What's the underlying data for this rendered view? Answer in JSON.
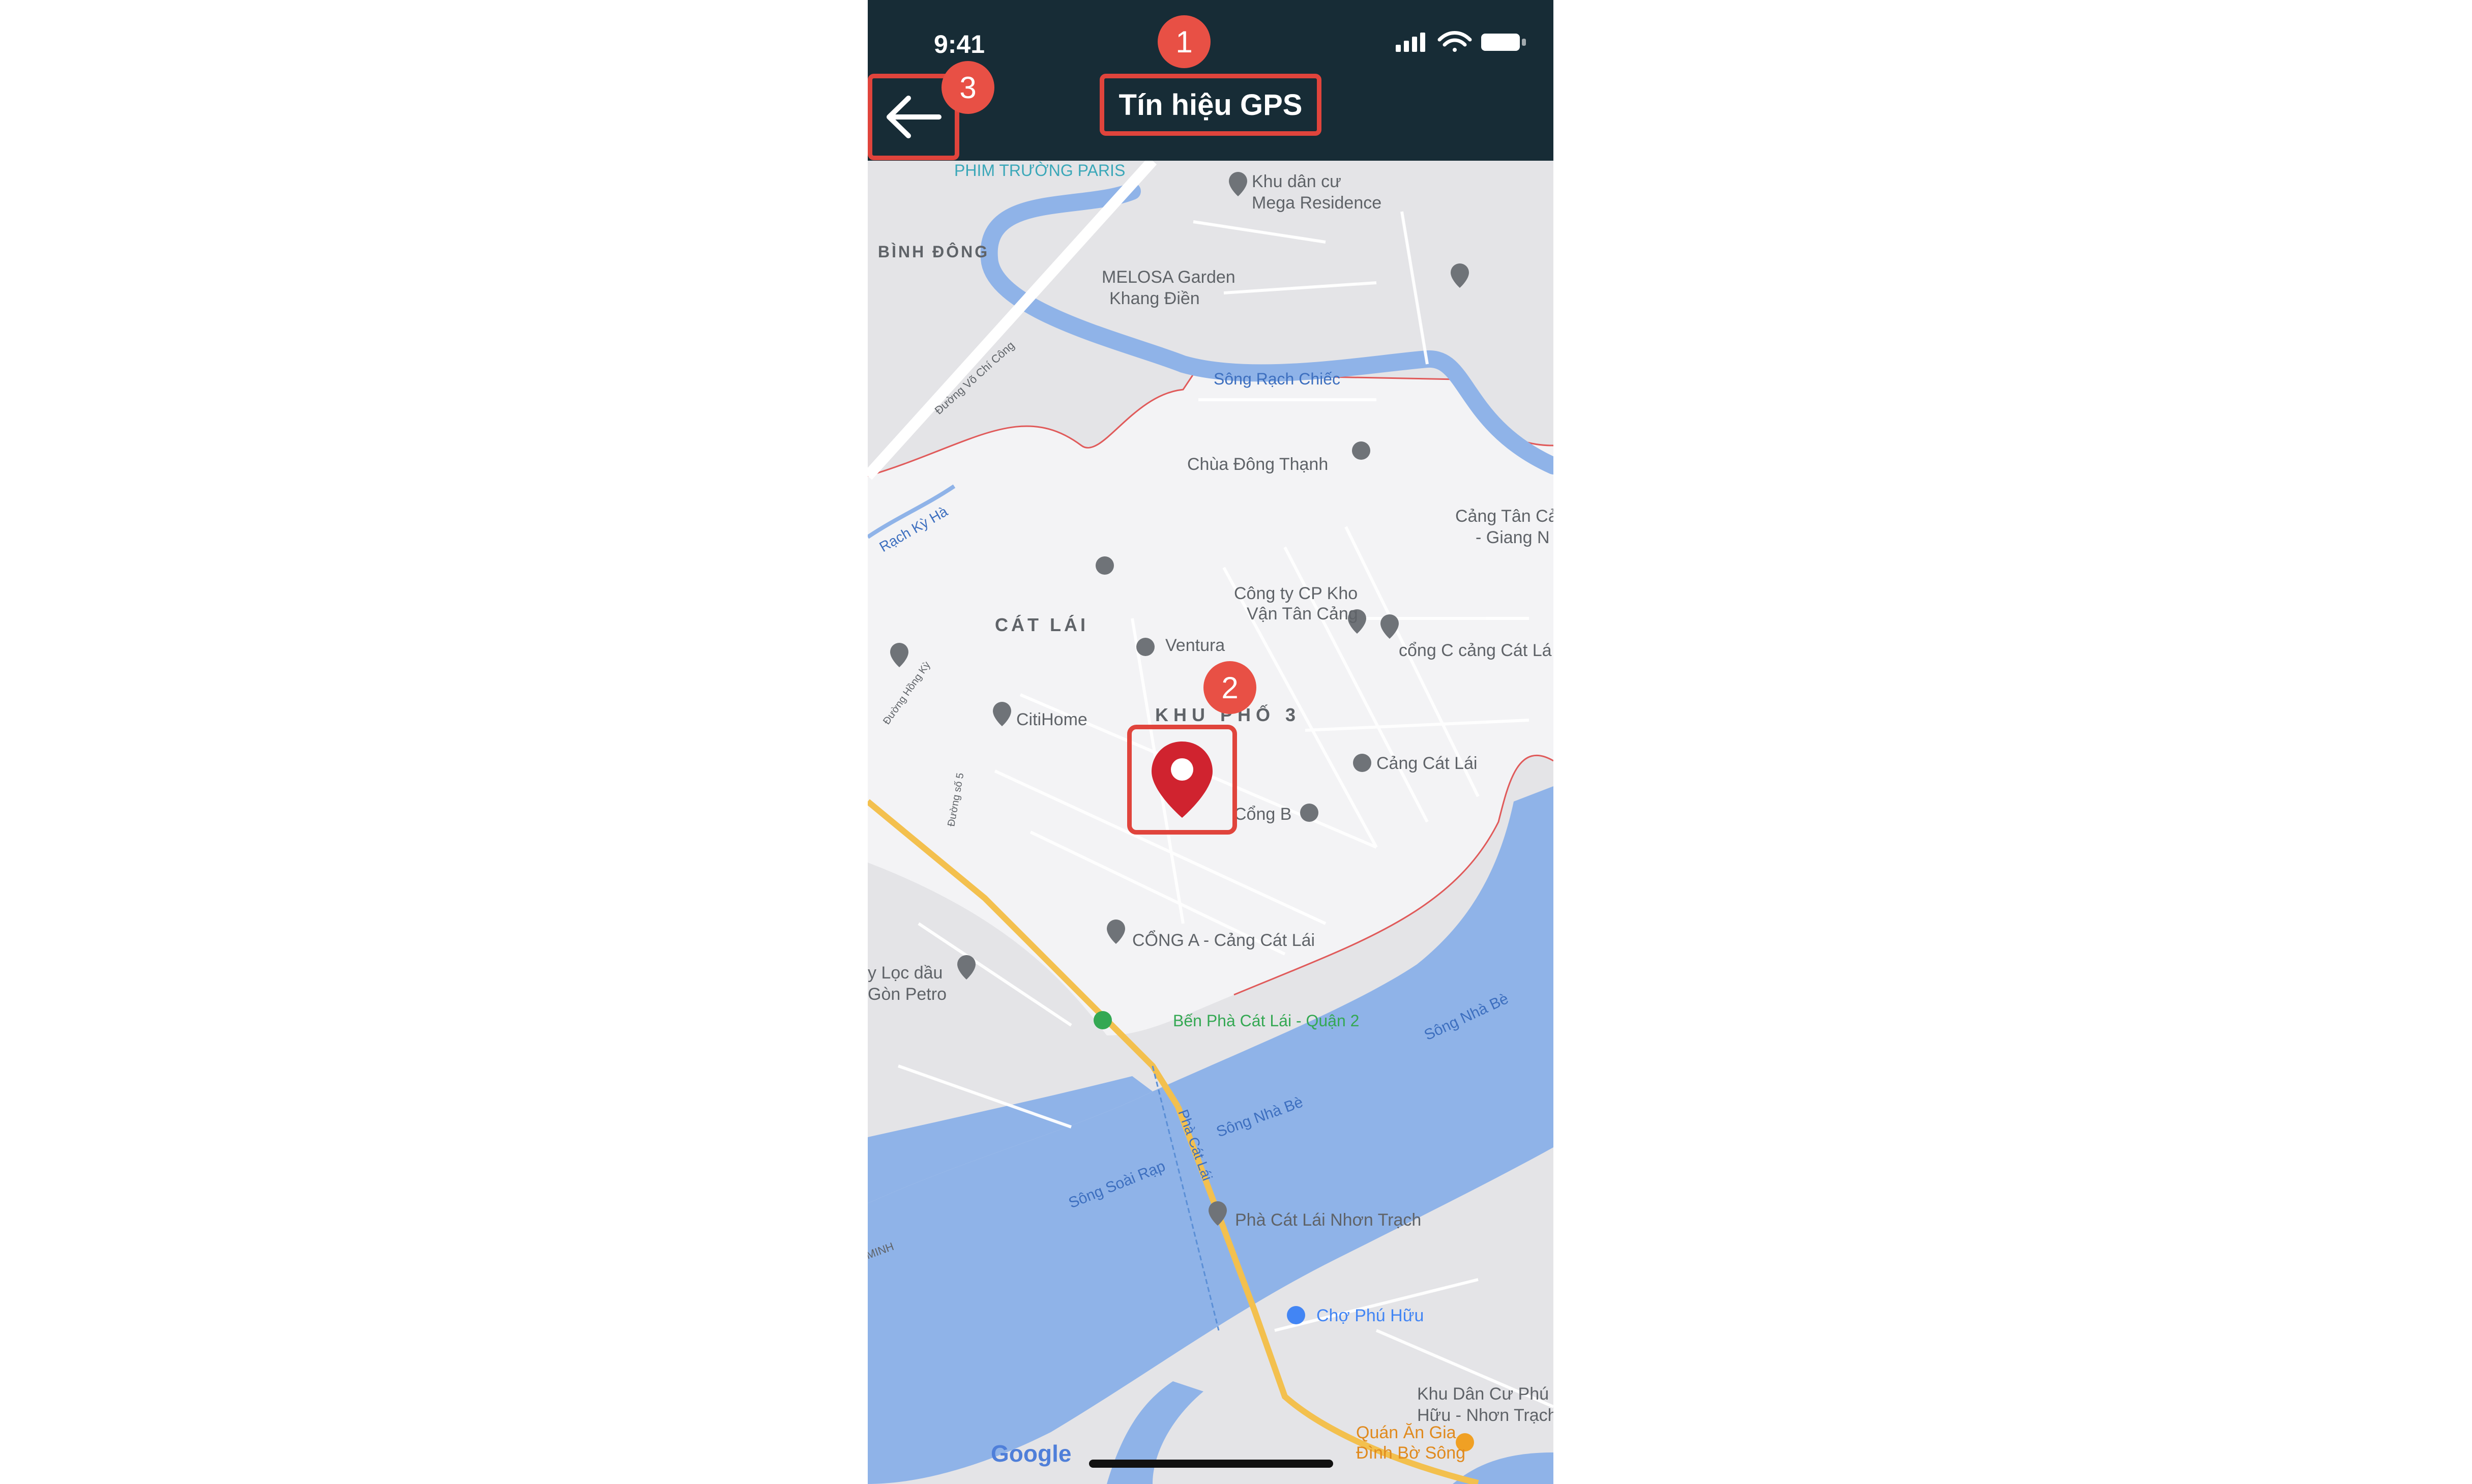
{
  "status_bar": {
    "time": "9:41"
  },
  "header": {
    "title": "Tín hiệu GPS",
    "back_icon": "arrow-left-icon"
  },
  "annotations": [
    "1",
    "2",
    "3"
  ],
  "map": {
    "provider_logo": "Google",
    "areas": [
      "BÌNH ĐÔNG",
      "CÁT LÁI",
      "KHU PHỐ 3"
    ],
    "rivers": [
      "Sông Rạch Chiếc",
      "Rạch Kỳ Hà",
      "Sông Nhà Bè",
      "Sông Soài Rạp",
      "Phà Cát Lái"
    ],
    "places": [
      "PHIM TRƯỜNG PARIS",
      "Khu dân cư",
      "Mega Residence",
      "MELOSA Garden",
      "Khang Điền",
      "Chùa Đông Thạnh",
      "Cảng Tân Cả",
      "- Giang N",
      "Công ty CP Kho",
      "Vận Tân Cảng",
      "Ventura",
      "cổng C cảng Cát Lá",
      "CitiHome",
      "Cảng Cát Lái",
      "Cổng B",
      "CỔNG A - Cảng Cát Lái",
      "y Lọc dầu",
      "Gòn Petro",
      "Bến Phà Cát Lái - Quận 2",
      "Phà Cát Lái Nhơn Trạch",
      "Chợ Phú Hữu",
      "Khu Dân Cư Phú",
      "Hữu - Nhơn Trạch",
      "Quán Ăn Gia",
      "Đình Bờ Sông"
    ],
    "streets": [
      "Đường Võ Chí Công",
      "Đường Hồng Kỳ",
      "Đường số 5",
      "MINH"
    ],
    "colors": {
      "land": "#e9e9ec",
      "district": "#f3f3f5",
      "water": "#8fb3e8",
      "boundary": "#e05a5a",
      "road_major": "#f3c04e",
      "marker": "#d0232f"
    }
  }
}
